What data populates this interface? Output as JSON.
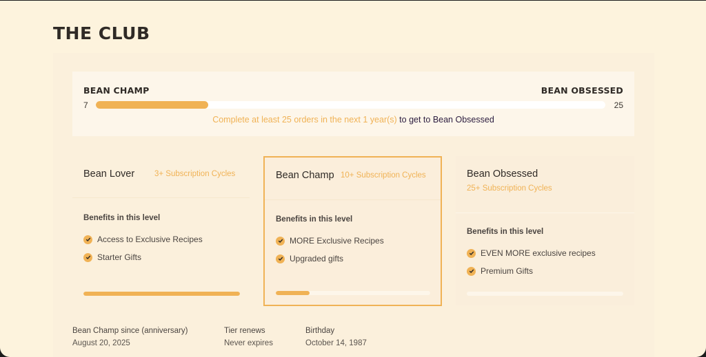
{
  "page": {
    "title": "THE CLUB"
  },
  "progress": {
    "current_tier": "BEAN CHAMP",
    "next_tier": "BEAN OBSESSED",
    "current_count": "7",
    "target_count": "25",
    "fill_fraction": 0.22,
    "message_accent": "Complete at least 25 orders in the next 1 year(s)",
    "message_rest": " to get to Bean Obsessed"
  },
  "tiers": [
    {
      "name": "Bean Lover",
      "cycles": "3+ Subscription Cycles",
      "benefits_heading": "Benefits in this level",
      "benefits": [
        "Access to Exclusive Recipes",
        "Starter Gifts"
      ],
      "progress_fraction": 1.0
    },
    {
      "name": "Bean Champ",
      "cycles": "10+ Subscription Cycles",
      "benefits_heading": "Benefits in this level",
      "benefits": [
        "MORE Exclusive Recipes",
        "Upgraded gifts"
      ],
      "progress_fraction": 0.22
    },
    {
      "name": "Bean Obsessed",
      "cycles": "25+ Subscription Cycles",
      "benefits_heading": "Benefits in this level",
      "benefits": [
        "EVEN MORE exclusive recipes",
        "Premium Gifts"
      ],
      "progress_fraction": 0
    }
  ],
  "footer": [
    {
      "label": "Bean Champ since (anniversary)",
      "value": "August 20, 2025"
    },
    {
      "label": "Tier renews",
      "value": "Never expires"
    },
    {
      "label": "Birthday",
      "value": "October 14, 1987"
    }
  ],
  "colors": {
    "accent": "#f0b255",
    "background": "#fdf3dd",
    "panel": "#fbf0dc",
    "text_dark": "#2f2a26",
    "message_dark": "#2b1c3f"
  },
  "icons": {
    "benefit_bullet": "check-circle-icon"
  }
}
